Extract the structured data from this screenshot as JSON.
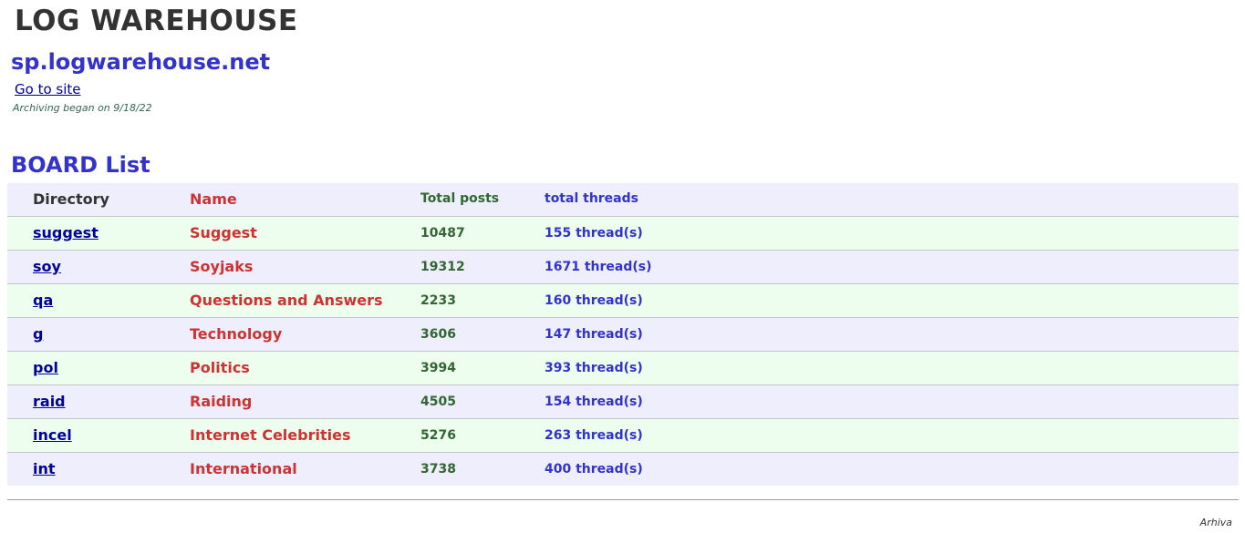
{
  "header": {
    "title": "LOG WAREHOUSE",
    "domain": "sp.logwarehouse.net",
    "go_link": "Go to site",
    "archive_note": "Archiving began on 9/18/22"
  },
  "boards": {
    "heading": "BOARD List",
    "columns": {
      "directory": "Directory",
      "name": "Name",
      "total_posts": "Total posts",
      "total_threads": "total threads"
    },
    "rows": [
      {
        "directory": "suggest",
        "name": "Suggest",
        "posts": "10487",
        "threads": "155 thread(s)"
      },
      {
        "directory": "soy",
        "name": "Soyjaks",
        "posts": "19312",
        "threads": "1671 thread(s)"
      },
      {
        "directory": "qa",
        "name": "Questions and Answers",
        "posts": "2233",
        "threads": "160 thread(s)"
      },
      {
        "directory": "g",
        "name": "Technology",
        "posts": "3606",
        "threads": "147 thread(s)"
      },
      {
        "directory": "pol",
        "name": "Politics",
        "posts": "3994",
        "threads": "393 thread(s)"
      },
      {
        "directory": "raid",
        "name": "Raiding",
        "posts": "4505",
        "threads": "154 thread(s)"
      },
      {
        "directory": "incel",
        "name": "Internet Celebrities",
        "posts": "5276",
        "threads": "263 thread(s)"
      },
      {
        "directory": "int",
        "name": "International",
        "posts": "3738",
        "threads": "400 thread(s)"
      }
    ]
  },
  "footer": {
    "text": "Arhiva"
  },
  "colors": {
    "title": "#333333",
    "accent_blue": "#3333cc",
    "name_red": "#cc3333",
    "posts_green": "#336633",
    "link_navy": "#000099",
    "row_blue": "#eeeefd",
    "row_green": "#eefeee"
  }
}
